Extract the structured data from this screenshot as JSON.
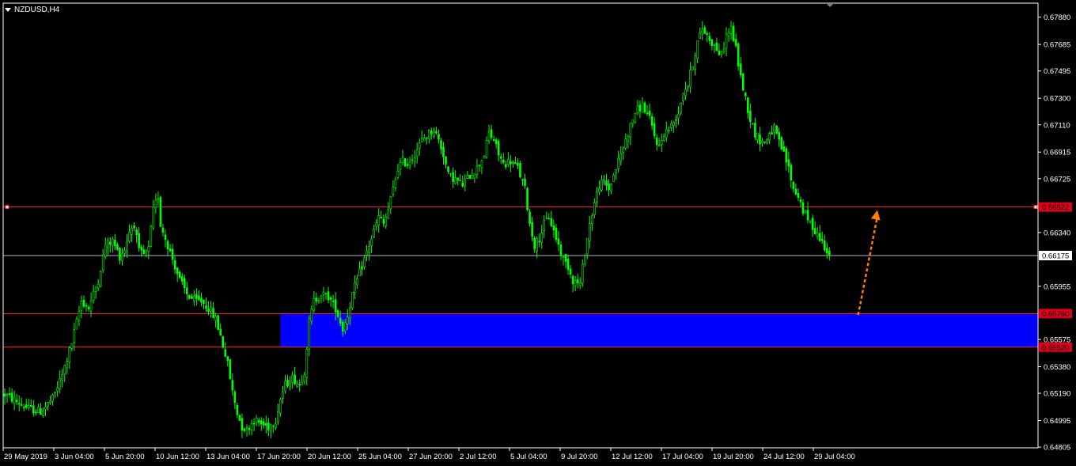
{
  "window": {
    "title": "NZDUSD,H4"
  },
  "colors": {
    "background": "#000000",
    "frame": "#ffffff",
    "candle": "#00ff00",
    "hline": "#ff2a2a",
    "hline_label_bg": "#e0001c",
    "bid_line": "#b4b4c8",
    "zone": "#0000ff",
    "arrow": "#ff7f00"
  },
  "chart_data": {
    "type": "candlestick",
    "symbol": "NZDUSD",
    "timeframe": "H4",
    "ylim": [
      0.648,
      0.6798
    ],
    "y_ticks": [
      "0.67880",
      "0.67685",
      "0.67495",
      "0.67300",
      "0.67110",
      "0.66915",
      "0.66725",
      "0.66340",
      "0.65955",
      "0.65575",
      "0.65380",
      "0.65190",
      "0.64995",
      "0.64805"
    ],
    "x_ticks": [
      "29 May 2019",
      "3 Jun 04:00",
      "5 Jun 20:00",
      "10 Jun 12:00",
      "13 Jun 04:00",
      "17 Jun 20:00",
      "20 Jun 12:00",
      "25 Jun 04:00",
      "27 Jun 20:00",
      "2 Jul 12:00",
      "5 Jul 04:00",
      "9 Jul 20:00",
      "12 Jul 12:00",
      "17 Jul 04:00",
      "19 Jul 20:00",
      "24 Jul 12:00",
      "29 Jul 04:00"
    ],
    "price_path": [
      [
        0,
        0.6518
      ],
      [
        5,
        0.6513
      ],
      [
        10,
        0.6508
      ],
      [
        15,
        0.6506
      ],
      [
        20,
        0.6515
      ],
      [
        24,
        0.6532
      ],
      [
        28,
        0.6555
      ],
      [
        32,
        0.6585
      ],
      [
        35,
        0.658
      ],
      [
        39,
        0.66
      ],
      [
        42,
        0.6625
      ],
      [
        45,
        0.6628
      ],
      [
        48,
        0.6617
      ],
      [
        50,
        0.6622
      ],
      [
        52,
        0.6635
      ],
      [
        54,
        0.664
      ],
      [
        56,
        0.662
      ],
      [
        58,
        0.6618
      ],
      [
        60,
        0.6622
      ],
      [
        62,
        0.665
      ],
      [
        64,
        0.666
      ],
      [
        65,
        0.664
      ],
      [
        67,
        0.663
      ],
      [
        70,
        0.6615
      ],
      [
        73,
        0.66
      ],
      [
        76,
        0.659
      ],
      [
        79,
        0.6585
      ],
      [
        82,
        0.6585
      ],
      [
        85,
        0.658
      ],
      [
        88,
        0.6572
      ],
      [
        90,
        0.656
      ],
      [
        93,
        0.654
      ],
      [
        95,
        0.652
      ],
      [
        97,
        0.6505
      ],
      [
        99,
        0.6495
      ],
      [
        101,
        0.6493
      ],
      [
        104,
        0.65
      ],
      [
        107,
        0.6497
      ],
      [
        110,
        0.6495
      ],
      [
        113,
        0.65
      ],
      [
        115,
        0.6515
      ],
      [
        117,
        0.6525
      ],
      [
        120,
        0.653
      ],
      [
        123,
        0.6525
      ],
      [
        125,
        0.6535
      ],
      [
        127,
        0.657
      ],
      [
        129,
        0.6585
      ],
      [
        132,
        0.659
      ],
      [
        135,
        0.6588
      ],
      [
        138,
        0.658
      ],
      [
        141,
        0.6565
      ],
      [
        143,
        0.6575
      ],
      [
        145,
        0.659
      ],
      [
        148,
        0.6605
      ],
      [
        151,
        0.662
      ],
      [
        154,
        0.6635
      ],
      [
        156,
        0.6645
      ],
      [
        158,
        0.664
      ],
      [
        160,
        0.665
      ],
      [
        162,
        0.6665
      ],
      [
        164,
        0.668
      ],
      [
        166,
        0.6685
      ],
      [
        168,
        0.6683
      ],
      [
        171,
        0.669
      ],
      [
        174,
        0.67
      ],
      [
        177,
        0.6705
      ],
      [
        179,
        0.6708
      ],
      [
        181,
        0.67
      ],
      [
        183,
        0.669
      ],
      [
        185,
        0.6675
      ],
      [
        188,
        0.6672
      ],
      [
        191,
        0.6668
      ],
      [
        194,
        0.6675
      ],
      [
        197,
        0.668
      ],
      [
        200,
        0.669
      ],
      [
        202,
        0.6705
      ],
      [
        204,
        0.67
      ],
      [
        206,
        0.669
      ],
      [
        208,
        0.6683
      ],
      [
        211,
        0.6685
      ],
      [
        214,
        0.668
      ],
      [
        217,
        0.6665
      ],
      [
        219,
        0.664
      ],
      [
        221,
        0.6625
      ],
      [
        223,
        0.663
      ],
      [
        225,
        0.664
      ],
      [
        227,
        0.6645
      ],
      [
        229,
        0.6635
      ],
      [
        231,
        0.6625
      ],
      [
        233,
        0.6615
      ],
      [
        235,
        0.661
      ],
      [
        237,
        0.66
      ],
      [
        240,
        0.6597
      ],
      [
        242,
        0.662
      ],
      [
        244,
        0.664
      ],
      [
        246,
        0.6655
      ],
      [
        248,
        0.6668
      ],
      [
        250,
        0.667
      ],
      [
        252,
        0.6665
      ],
      [
        254,
        0.6675
      ],
      [
        257,
        0.669
      ],
      [
        260,
        0.6705
      ],
      [
        263,
        0.672
      ],
      [
        266,
        0.6725
      ],
      [
        269,
        0.6715
      ],
      [
        271,
        0.6703
      ],
      [
        273,
        0.6695
      ],
      [
        275,
        0.6705
      ],
      [
        278,
        0.671
      ],
      [
        281,
        0.672
      ],
      [
        283,
        0.6735
      ],
      [
        285,
        0.674
      ],
      [
        287,
        0.6755
      ],
      [
        289,
        0.677
      ],
      [
        291,
        0.678
      ],
      [
        293,
        0.6775
      ],
      [
        295,
        0.677
      ],
      [
        297,
        0.6765
      ],
      [
        299,
        0.676
      ],
      [
        301,
        0.6775
      ],
      [
        303,
        0.678
      ],
      [
        305,
        0.6765
      ],
      [
        307,
        0.6745
      ],
      [
        309,
        0.673
      ],
      [
        311,
        0.6715
      ],
      [
        313,
        0.6705
      ],
      [
        315,
        0.67
      ],
      [
        317,
        0.6698
      ],
      [
        319,
        0.6705
      ],
      [
        321,
        0.6708
      ],
      [
        323,
        0.6698
      ],
      [
        325,
        0.669
      ],
      [
        327,
        0.668
      ],
      [
        329,
        0.6665
      ],
      [
        331,
        0.666
      ],
      [
        333,
        0.665
      ],
      [
        335,
        0.6643
      ],
      [
        337,
        0.6638
      ],
      [
        339,
        0.6633
      ],
      [
        341,
        0.6627
      ],
      [
        343,
        0.6622
      ],
      [
        344,
        0.6618
      ]
    ],
    "price_lines": [
      {
        "label": "0.66522",
        "value": 0.66522,
        "style": "resistance"
      },
      {
        "label": "0.65760",
        "value": 0.6576,
        "style": "support-top"
      },
      {
        "label": "0.65520",
        "value": 0.6552,
        "style": "support-bottom"
      }
    ],
    "bid": {
      "label": "0.66175",
      "value": 0.66175
    },
    "zone": {
      "from_bar": 115,
      "top": 0.6576,
      "bottom": 0.6552
    },
    "projection_arrow": {
      "from_bar": 356,
      "from_price": 0.6575,
      "to_bar": 364,
      "to_price": 0.665
    }
  }
}
